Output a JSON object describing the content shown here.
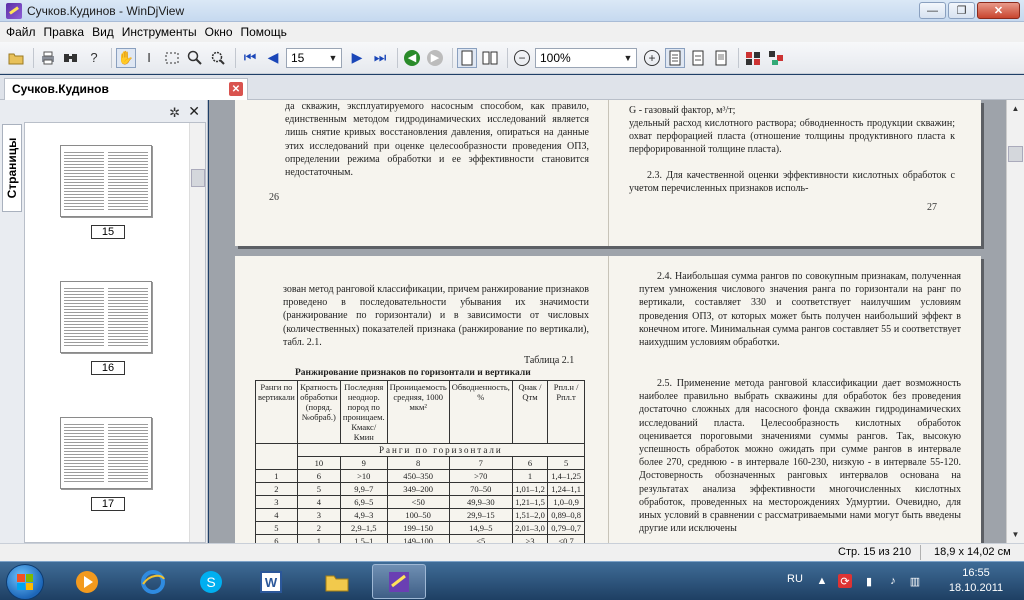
{
  "window": {
    "title": "Сучков.Кудинов - WinDjView",
    "btn_minimize": "—",
    "btn_maximize": "❐",
    "btn_close": "✕"
  },
  "menu": [
    "Файл",
    "Правка",
    "Вид",
    "Инструменты",
    "Окно",
    "Помощь"
  ],
  "toolbar": {
    "page_number": "15",
    "zoom": "100%"
  },
  "document_tab": {
    "label": "Сучков.Кудинов",
    "close": "✕"
  },
  "side_panel": {
    "tab_label": "Страницы",
    "thumbnails": [
      "15",
      "16",
      "17"
    ]
  },
  "page_top": {
    "left_text": "да скважин, эксплуатируемого насосным способом, как правило, единственным методом гидродинамических исследований является лишь снятие кривых восстановления давления, опираться на данные этих исследований при оценке целесообразности проведения ОПЗ, определении режима обработки и ее эффективности становится недостаточным.",
    "left_page_number": "26",
    "right_text_1": "G - газовый фактор, м³/т;",
    "right_text_2": "удельный расход кислотного раствора; обводненность продукции скважин; охват перфорацией пласта (отношение толщины продуктивного пласта к перфорированной толщине пласта).",
    "right_text_3": "2.3. Для качественной оценки эффективности кислотных обработок с учетом перечисленных признаков исполь-",
    "right_page_number": "27"
  },
  "page_bottom": {
    "left_text": "зован метод ранговой классификации, причем ранжирование признаков проведено в последовательности убывания их значимости (ранжирование по горизонтали) и в зависимости от числовых (количественных) показателей признака (ранжирование по вертикали), табл. 2.1.",
    "table_number": "Таблица 2.1",
    "table_title": "Ранжирование признаков по горизонтали и вертикали",
    "table_headers": [
      "Ранги по вертикали",
      "Кратность обработки (поряд. №обраб.)",
      "Последняя неоднор. пород по проницаем. Кмакс/Кмин",
      "Проницаемость средняя, 1000 мкм²",
      "Обводненность, %",
      "Qнак / Qтм",
      "Рпл.н / Рпл.т"
    ],
    "rank_label": "Ранги по горизонтали",
    "rank_values": [
      "10",
      "9",
      "8",
      "7",
      "6",
      "5"
    ],
    "rows": [
      [
        "1",
        "6",
        ">10",
        "450–350",
        ">70",
        "1",
        "1,4–1,25"
      ],
      [
        "2",
        "5",
        "9,9–7",
        "349–200",
        "70–50",
        "1,01–1,2",
        "1,24–1,1"
      ],
      [
        "3",
        "4",
        "6,9–5",
        "<50",
        "49,9–30",
        "1,21–1,5",
        "1,0–0,9"
      ],
      [
        "4",
        "3",
        "4,9–3",
        "100–50",
        "29,9–15",
        "1,51–2,0",
        "0,89–0,8"
      ],
      [
        "5",
        "2",
        "2,9–1,5",
        "199–150",
        "14,9–5",
        "2,01–3,0",
        "0,79–0,7"
      ],
      [
        "6",
        "1",
        "1,5–1",
        "149–100",
        "<5",
        ">3",
        "<0,7"
      ]
    ],
    "right_text_1": "2.4. Наибольшая сумма рангов по совокупным признакам, полученная путем умножения числового значения ранга по горизонтали на ранг по вертикали, составляет 330 и соответствует наилучшим условиям проведения ОПЗ, от которых может быть получен наибольший эффект в конечном итоге. Минимальная сумма рангов составляет 55 и соответствует наихудшим условиям обработки.",
    "right_text_2": "2.5. Применение метода ранговой классификации дает возможность наиболее правильно выбрать скважины для обработок без проведения достаточно сложных для насосного фонда скважин гидродинамических исследований пласта. Целесообразность кислотных обработок оценивается пороговыми значениями суммы рангов. Так, высокую успешность обработок можно ожидать при сумме рангов в интервале более 270, среднюю - в интервале 160-230, низкую - в интервале 55-120. Достоверность обозначенных ранговых интервалов основана на результатах анализа эффективности многочисленных кислотных обработок, проведенных на месторождениях Удмуртии. Очевидно, для иных условий в сравнении с рассматриваемыми нами могут быть введены другие или исключены"
  },
  "status": {
    "page": "Стр. 15 из 210",
    "size": "18,9 x 14,02 см"
  },
  "taskbar": {
    "lang": "RU",
    "time": "16:55",
    "date": "18.10.2011"
  }
}
